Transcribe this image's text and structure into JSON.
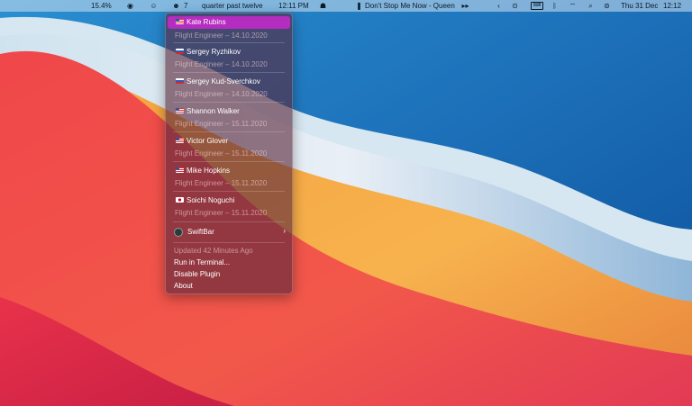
{
  "menubar": {
    "battery": "15.4%",
    "swiftbar_count": "7",
    "fuzzy_time": "quarter past twelve",
    "clock_small": "12:11 PM",
    "now_playing": "Don't Stop Me Now - Queen",
    "date": "Thu 31 Dec",
    "time": "12:12",
    "icons": [
      "globe-icon",
      "emoji-icon",
      "astronaut-icon",
      "ghost-icon",
      "pause-icon",
      "fast-forward-icon",
      "chevron-left-icon",
      "play-circle-icon",
      "keyboard-icon",
      "bluetooth-icon",
      "wifi-off-icon",
      "search-icon",
      "control-center-icon"
    ]
  },
  "menu": {
    "astronauts": [
      {
        "name": "Kate Rubins",
        "flag": "us",
        "role": "Flight Engineer – 14.10.2020"
      },
      {
        "name": "Sergey Ryzhikov",
        "flag": "ru",
        "role": "Flight Engineer – 14.10.2020"
      },
      {
        "name": "Sergey Kud-Sverchkov",
        "flag": "ru",
        "role": "Flight Engineer – 14.10.2020"
      },
      {
        "name": "Shannon Walker",
        "flag": "us",
        "role": "Flight Engineer – 15.11.2020"
      },
      {
        "name": "Victor Glover",
        "flag": "us",
        "role": "Flight Engineer – 15.11.2020"
      },
      {
        "name": "Mike Hopkins",
        "flag": "us",
        "role": "Flight Engineer – 15.11.2020"
      },
      {
        "name": "Soichi Noguchi",
        "flag": "jp",
        "role": "Flight Engineer – 15.11.2020"
      }
    ],
    "app_label": "SwiftBar",
    "updated": "Updated 42 Minutes Ago",
    "run_terminal": "Run in Terminal...",
    "disable_plugin": "Disable Plugin",
    "about": "About"
  },
  "colors": {
    "highlight": "#b52cc0",
    "menu_bg": "#58263a"
  }
}
